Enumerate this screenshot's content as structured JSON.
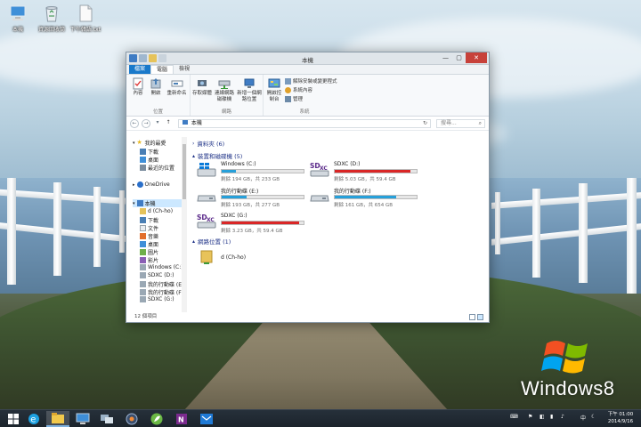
{
  "desktop": {
    "icons": [
      {
        "label": "本機"
      },
      {
        "label": "資源回收筒"
      },
      {
        "label": "下午韓語.txt"
      }
    ],
    "brand_text": "Windows8"
  },
  "window": {
    "title": "本機",
    "tabs": [
      {
        "label": "檔案"
      },
      {
        "label": "電腦"
      },
      {
        "label": "檢視"
      }
    ],
    "ribbon": {
      "groups": [
        {
          "name": "位置",
          "buttons": [
            "內容",
            "開啟",
            "重新命名"
          ]
        },
        {
          "name": "網路",
          "buttons": [
            "存取媒體",
            "連線網路磁碟機",
            "新增一個網路位置"
          ]
        },
        {
          "name": "系統",
          "big_button": "開啟控制台",
          "small_buttons": [
            "解除安裝或變更程式",
            "系統內容",
            "管理"
          ]
        }
      ]
    },
    "address": {
      "back": "←",
      "forward": "→",
      "up": "↑",
      "path": "本機",
      "refresh": "↻",
      "search_placeholder": "搜尋..."
    },
    "nav": {
      "favorites": "我的最愛",
      "downloads": "下載",
      "desktop": "桌面",
      "recent": "最近的位置",
      "onedrive": "OneDrive",
      "thispc": "本機",
      "items": [
        "d (Ch-ho)",
        "下載",
        "文件",
        "音樂",
        "桌面",
        "圖片",
        "影片",
        "Windows (C:)",
        "SDXC (D:)",
        "我的行動碟 (E",
        "我的行動碟 (F",
        "SDXC (G:)"
      ]
    },
    "sections": {
      "folders": "資料夾 (6)",
      "devices": "裝置和磁碟機 (5)",
      "network": "網路位置 (1)"
    },
    "drives": [
      {
        "name": "Windows (C:)",
        "info": "剩餘 194 GB，共 233 GB",
        "used_fraction": 0.17,
        "color": "#26a0da"
      },
      {
        "name": "SDXC (D:)",
        "info": "剩餘 5.03 GB，共 59.4 GB",
        "used_fraction": 0.92,
        "color": "#da2626"
      },
      {
        "name": "我的行動碟 (E:)",
        "info": "剩餘 193 GB，共 277 GB",
        "used_fraction": 0.3,
        "color": "#26a0da"
      },
      {
        "name": "我的行動碟 (F:)",
        "info": "剩餘 161 GB，共 654 GB",
        "used_fraction": 0.75,
        "color": "#26a0da"
      },
      {
        "name": "SDXC (G:)",
        "info": "剩餘 3.23 GB，共 59.4 GB",
        "used_fraction": 0.95,
        "color": "#da2626"
      }
    ],
    "sd_logo_text": "SD",
    "sd_logo_sub": "XC",
    "network_location": {
      "name": "d (Ch-ho)"
    },
    "status": "12 個項目"
  },
  "taskbar": {
    "tray_lang": "中",
    "clock_time": "下午 01:00",
    "clock_date": "2014/9/16"
  }
}
